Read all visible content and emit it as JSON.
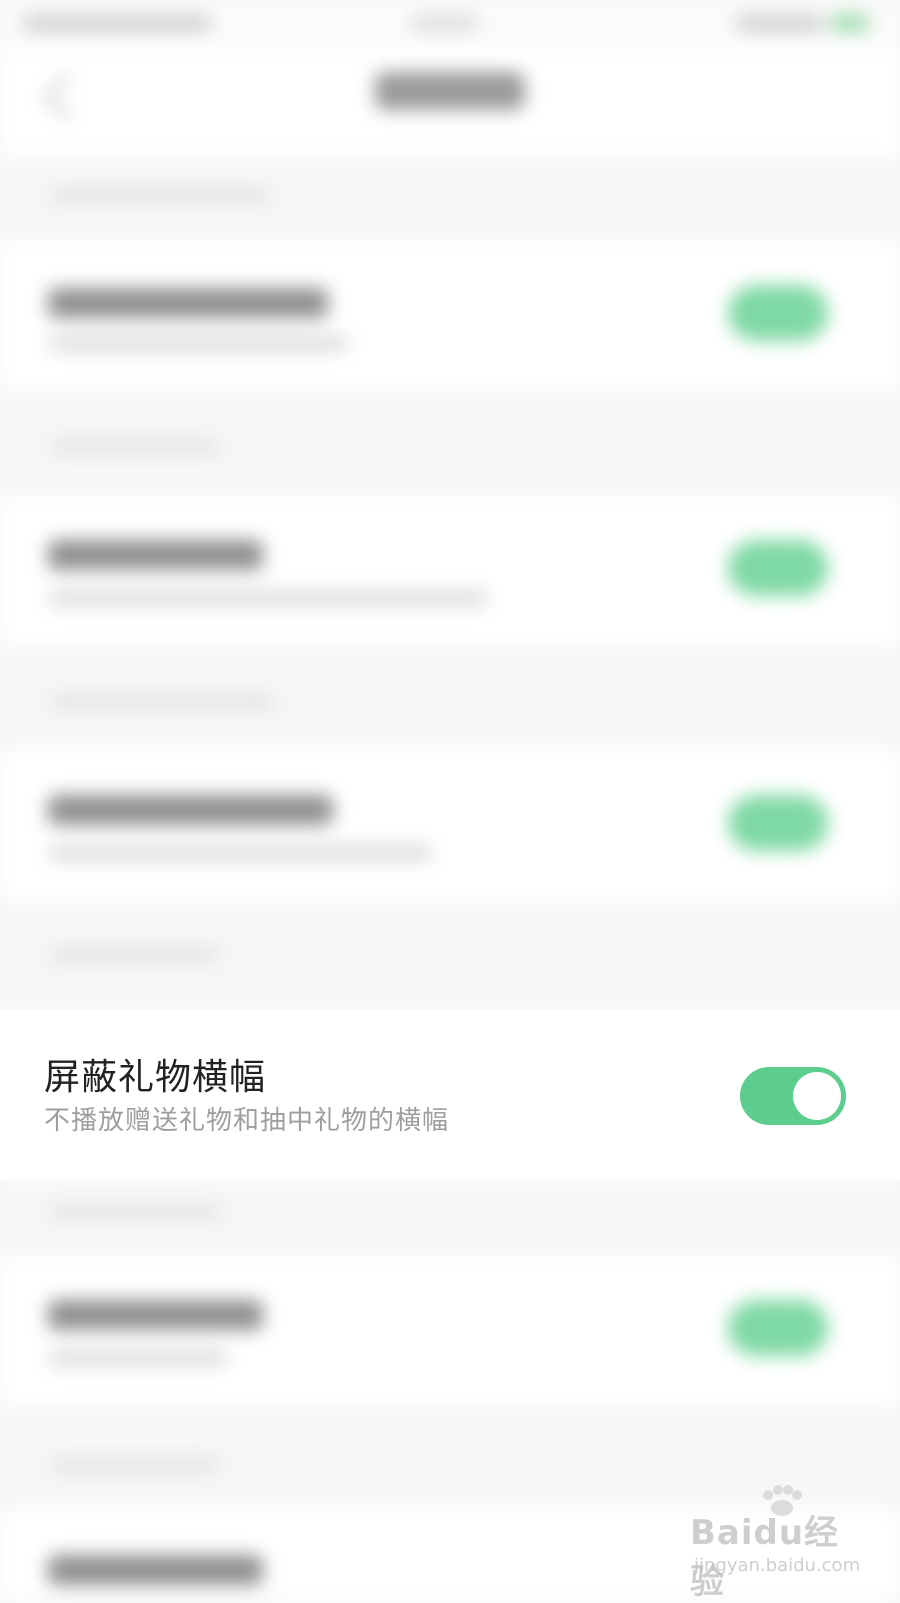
{
  "focused_setting": {
    "title": "屏蔽礼物横幅",
    "description": "不播放赠送礼物和抽中礼物的横幅",
    "toggle_on": true
  },
  "colors": {
    "toggle_on": "#5ccd8e",
    "background": "#f7f7f7",
    "card": "#ffffff",
    "title_text": "#222222",
    "subtitle_text": "#9e9e9e"
  },
  "watermark": {
    "brand": "Baidu经验",
    "url": "jingyan.baidu.com"
  }
}
